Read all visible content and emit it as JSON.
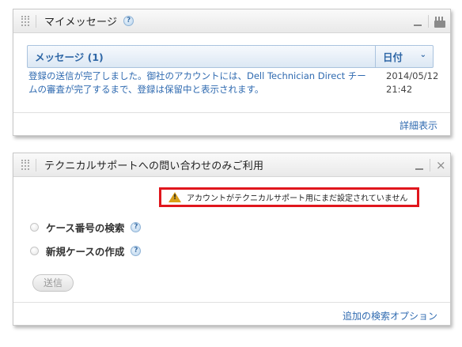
{
  "my_messages": {
    "title": "マイメッセージ",
    "help": "?",
    "table": {
      "col_message": "メッセージ (1)",
      "col_date": "日付",
      "sort_icon": "chevron-down-icon",
      "rows": [
        {
          "text": "登録の送信が完了しました。御社のアカウントには、Dell Technician Direct チームの審査が完了するまで、登録は保留中と表示されます。",
          "date": "2014/05/12",
          "time": "21:42"
        }
      ]
    },
    "details_link": "詳細表示"
  },
  "tech_support": {
    "title": "テクニカルサポートへの問い合わせのみご利用",
    "close": "×",
    "warning": "アカウントがテクニカルサポート用にまだ設定されていません",
    "options": [
      {
        "label": "ケース番号の検索",
        "help": "?"
      },
      {
        "label": "新規ケースの作成",
        "help": "?"
      }
    ],
    "submit_label": "送信",
    "more_search_link": "追加の検索オプション"
  },
  "colors": {
    "link": "#2f6ab0",
    "warning_border": "#e0161d",
    "header_bg": "#dce8f4"
  }
}
